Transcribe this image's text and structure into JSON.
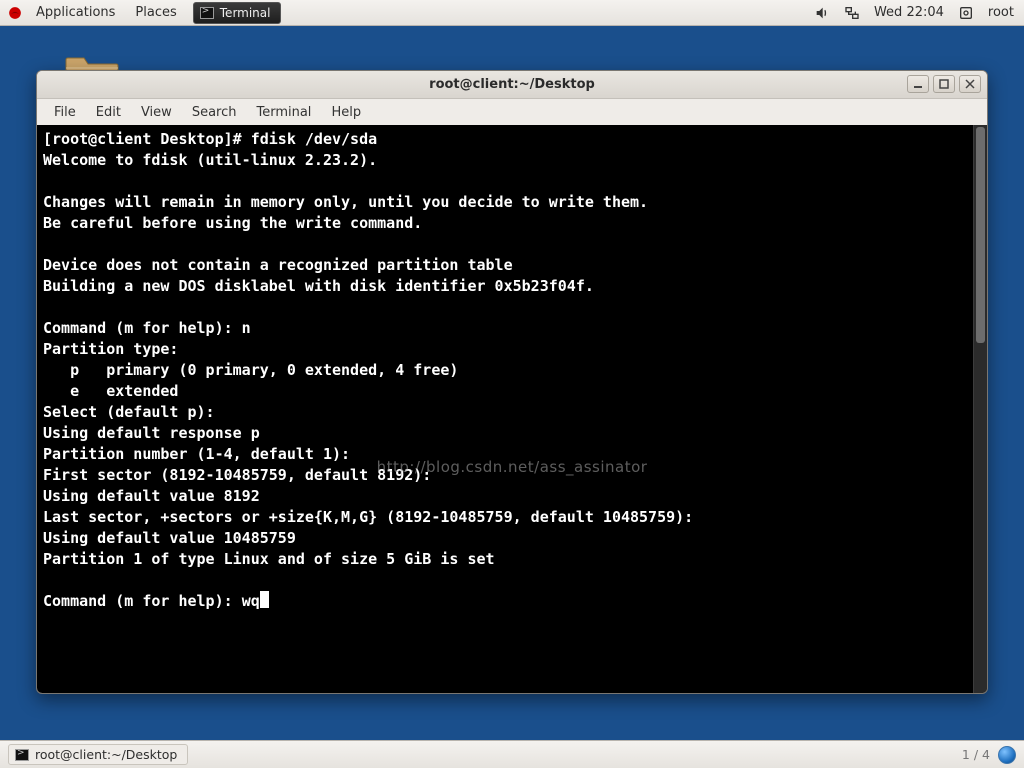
{
  "panel": {
    "applications": "Applications",
    "places": "Places",
    "task_app": "Terminal",
    "clock": "Wed 22:04",
    "user": "root"
  },
  "window": {
    "title": "root@client:~/Desktop",
    "menus": {
      "file": "File",
      "edit": "Edit",
      "view": "View",
      "search": "Search",
      "terminal": "Terminal",
      "help": "Help"
    }
  },
  "terminal": {
    "prompt_line": "[root@client Desktop]# fdisk /dev/sda",
    "welcome": "Welcome to fdisk (util-linux 2.23.2).",
    "blank1": "",
    "changes1": "Changes will remain in memory only, until you decide to write them.",
    "changes2": "Be careful before using the write command.",
    "blank2": "",
    "device1": "Device does not contain a recognized partition table",
    "device2": "Building a new DOS disklabel with disk identifier 0x5b23f04f.",
    "blank3": "",
    "cmd1": "Command (m for help): n",
    "ptype": "Partition type:",
    "p_primary": "   p   primary (0 primary, 0 extended, 4 free)",
    "p_extended": "   e   extended",
    "select": "Select (default p): ",
    "using_p": "Using default response p",
    "partnum": "Partition number (1-4, default 1): ",
    "first": "First sector (8192-10485759, default 8192): ",
    "using8192": "Using default value 8192",
    "last": "Last sector, +sectors or +size{K,M,G} (8192-10485759, default 10485759): ",
    "usinglast": "Using default value 10485759",
    "partset": "Partition 1 of type Linux and of size 5 GiB is set",
    "blank4": "",
    "cmd2_prefix": "Command (m for help): ",
    "cmd2_input": "wq",
    "watermark": "http://blog.csdn.net/ass_assinator"
  },
  "bottom": {
    "task": "root@client:~/Desktop",
    "pager": "1 / 4"
  }
}
